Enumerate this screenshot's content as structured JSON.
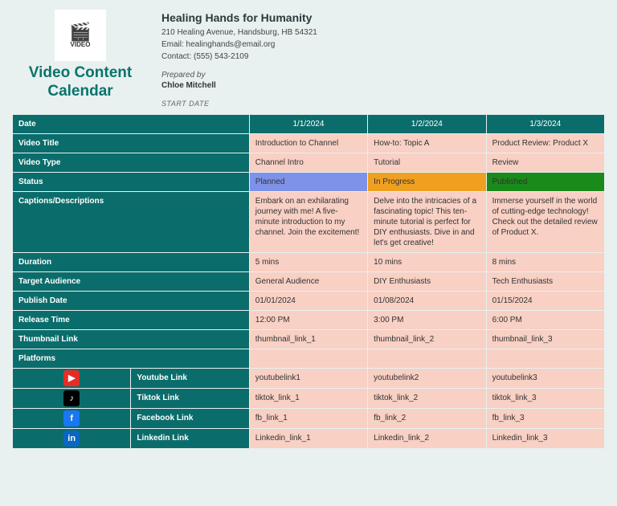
{
  "app_title_line1": "Video Content",
  "app_title_line2": "Calendar",
  "logo_text": "VIDEO",
  "org": {
    "name": "Healing Hands for Humanity",
    "address": "210 Healing Avenue, Handsburg, HB 54321",
    "email": "Email: healinghands@email.org",
    "contact": "Contact: (555) 543-2109"
  },
  "prepared_by_label": "Prepared by",
  "prepared_by": "Chloe Mitchell",
  "start_date_label": "START DATE",
  "headers": {
    "date": "Date",
    "title": "Video Title",
    "type": "Video Type",
    "status": "Status",
    "captions": "Captions/Descriptions",
    "duration": "Duration",
    "audience": "Target Audience",
    "publish": "Publish Date",
    "release": "Release Time",
    "thumb": "Thumbnail Link",
    "platforms": "Platforms",
    "youtube": "Youtube Link",
    "tiktok": "Tiktok Link",
    "facebook": "Facebook Link",
    "linkedin": "Linkedin Link"
  },
  "cols": [
    {
      "date": "1/1/2024",
      "title": "Introduction to Channel",
      "type": "Channel Intro",
      "status": "Planned",
      "caption": "Embark on an exhilarating journey with me! A five-minute introduction to my channel. Join the excitement!",
      "duration": "5 mins",
      "audience": "General Audience",
      "publish": "01/01/2024",
      "release": "12:00 PM",
      "thumb": "thumbnail_link_1",
      "youtube": "youtubelink1",
      "tiktok": "tiktok_link_1",
      "facebook": "fb_link_1",
      "linkedin": "Linkedin_link_1"
    },
    {
      "date": "1/2/2024",
      "title": "How-to: Topic A",
      "type": "Tutorial",
      "status": "In Progress",
      "caption": "Delve into the intricacies of a fascinating topic! This ten-minute tutorial is perfect for DIY enthusiasts. Dive in and let's get creative!",
      "duration": "10 mins",
      "audience": "DIY Enthusiasts",
      "publish": "01/08/2024",
      "release": "3:00 PM",
      "thumb": "thumbnail_link_2",
      "youtube": "youtubelink2",
      "tiktok": "tiktok_link_2",
      "facebook": "fb_link_2",
      "linkedin": "Linkedin_link_2"
    },
    {
      "date": "1/3/2024",
      "title": "Product Review: Product X",
      "type": "Review",
      "status": "Published",
      "caption": "Immerse yourself in the world of cutting-edge technology! Check out the detailed review of Product X.",
      "duration": "8 mins",
      "audience": "Tech Enthusiasts",
      "publish": "01/15/2024",
      "release": "6:00 PM",
      "thumb": "thumbnail_link_3",
      "youtube": "youtubelink3",
      "tiktok": "tiktok_link_3",
      "facebook": "fb_link_3",
      "linkedin": "Linkedin_link_3"
    }
  ]
}
